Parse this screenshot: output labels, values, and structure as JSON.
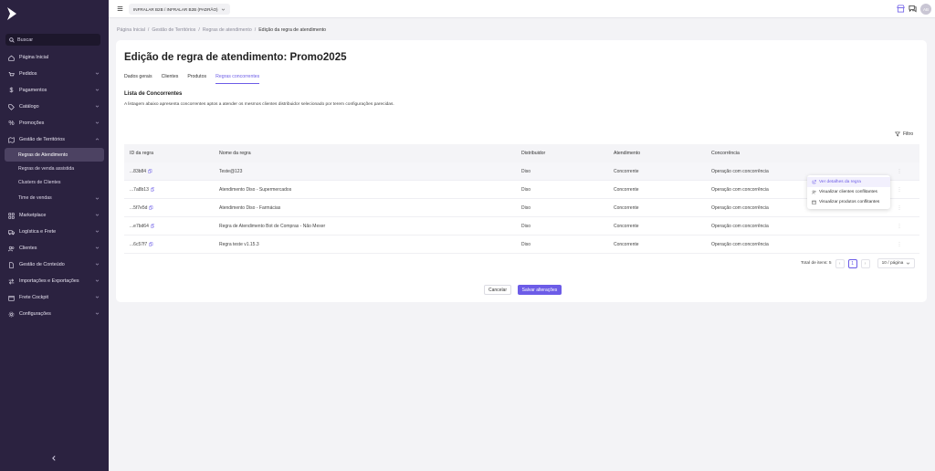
{
  "sidebar": {
    "search_label": "Buscar",
    "items": [
      {
        "label": "Página Inicial",
        "icon": "home-icon",
        "chevron": false
      },
      {
        "label": "Pedidos",
        "icon": "cart-icon",
        "chevron": true
      },
      {
        "label": "Pagamentos",
        "icon": "dollar-icon",
        "chevron": true
      },
      {
        "label": "Catálogo",
        "icon": "tag-icon",
        "chevron": true
      },
      {
        "label": "Promoções",
        "icon": "percent-icon",
        "chevron": true
      },
      {
        "label": "Gestão de Territórios",
        "icon": "map-icon",
        "chevron": true
      }
    ],
    "sub_items": [
      {
        "label": "Regras de Atendimento",
        "active": true
      },
      {
        "label": "Regras de venda assistida",
        "active": false
      },
      {
        "label": "Clusters de Clientes",
        "active": false
      },
      {
        "label": "Time de vendas",
        "active": false
      }
    ],
    "items_after": [
      {
        "label": "Marketplace",
        "icon": "grid-icon"
      },
      {
        "label": "Logística e Frete",
        "icon": "truck-icon"
      },
      {
        "label": "Clientes",
        "icon": "users-icon"
      },
      {
        "label": "Gestão de Conteúdo",
        "icon": "file-icon"
      },
      {
        "label": "Importações e Exportações",
        "icon": "swap-icon"
      },
      {
        "label": "Frete Cockpit",
        "icon": "box-icon"
      },
      {
        "label": "Configurações",
        "icon": "gear-icon"
      }
    ]
  },
  "topbar": {
    "org_selector": "INFRALAR B2B / INFRALAR B2B (PADRÃO)",
    "avatar_initials": "AB"
  },
  "breadcrumb": [
    "Página Inicial",
    "Gestão de Territórios",
    "Regras de atendimento",
    "Edição da regra de atendimento"
  ],
  "page": {
    "title": "Edição de regra de atendimento: Promo2025",
    "tabs": [
      {
        "label": "Dados gerais",
        "active": false
      },
      {
        "label": "Clientes",
        "active": false
      },
      {
        "label": "Produtos",
        "active": false
      },
      {
        "label": "Regras concorrentes",
        "active": true
      }
    ],
    "section_title": "Lista de Concorrentes",
    "section_desc": "A listagem abaixo apresenta concorrentes aptos a atender os mesmos clientes distribuidor selecionado por terem configurações parecidas.",
    "filter_label": "Filtro"
  },
  "table": {
    "headers": [
      "ID da regra",
      "Nome da regra",
      "Distribuidor",
      "Atendimento",
      "Concorrência"
    ],
    "rows": [
      {
        "id": "...83b84",
        "name": "Teste@123",
        "distributor": "Diso",
        "service": "Concorrente",
        "competition": "Operação com concorrência"
      },
      {
        "id": "...7a8b13",
        "name": "Atendimento Diso - Supermercados",
        "distributor": "Diso",
        "service": "Concorrente",
        "competition": "Operação com concorrência"
      },
      {
        "id": "...5f7e5d",
        "name": "Atendimento Diso - Farmácias",
        "distributor": "Diso",
        "service": "Concorrente",
        "competition": "Operação com concorrência"
      },
      {
        "id": "...e7bd64",
        "name": "Regra de Atendimento Bot de Compras - Não Mexer",
        "distributor": "Diso",
        "service": "Concorrente",
        "competition": "Operação com concorrência"
      },
      {
        "id": "...6c57f7",
        "name": "Regra teste v1.15.3",
        "distributor": "Diso",
        "service": "Concorrente",
        "competition": "Operação com concorrência"
      }
    ]
  },
  "popover": {
    "items": [
      {
        "label": "Ver detalhes da regra",
        "icon": "external-link-icon"
      },
      {
        "label": "Visualizar clientes conflitantes",
        "icon": "users-icon"
      },
      {
        "label": "Visualizar produtos conflitantes",
        "icon": "box-icon"
      }
    ]
  },
  "pagination": {
    "total_label": "Total de itens: 5",
    "current_page": "1",
    "page_size": "10 / página"
  },
  "actions": {
    "cancel": "Cancelar",
    "save": "Salvar alterações"
  },
  "colors": {
    "sidebar_bg": "#2b2240",
    "accent": "#6c5ce7"
  }
}
